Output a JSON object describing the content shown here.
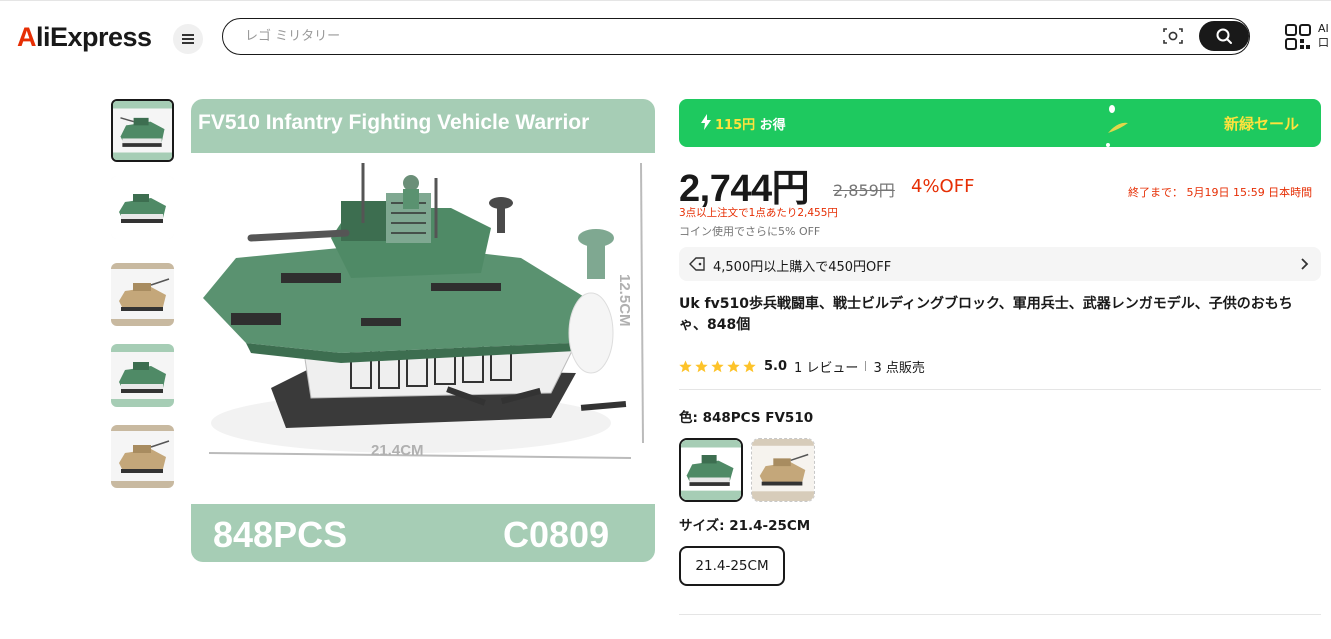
{
  "header": {
    "logo_text": "AliExpress",
    "logo_first": "A",
    "logo_rest": "liExpress",
    "search_placeholder": "レゴ ミリタリー",
    "qr_label": "AI 口",
    "icons": [
      "menu-icon",
      "camera-search-icon",
      "search-icon",
      "qr-code-icon"
    ]
  },
  "gallery": {
    "thumbnails": [
      {
        "theme": "green",
        "selected": true
      },
      {
        "theme": "white",
        "selected": false
      },
      {
        "theme": "tan",
        "selected": false
      },
      {
        "theme": "green",
        "selected": false
      },
      {
        "theme": "tan",
        "selected": false
      }
    ],
    "main_image": {
      "headline": "FV510 Infantry  Fighting Vehicle Warrior",
      "width_label": "21.4CM",
      "height_label": "12.5CM",
      "pcs_label": "848PCS",
      "code_label": "C0809"
    }
  },
  "product": {
    "sale_banner": {
      "savings_amount": "115円",
      "savings_suffix": " お得",
      "event_name": "新緑セール",
      "color": "#1ec95f"
    },
    "price": "2,744円",
    "original_price": "2,859円",
    "discount": "4%OFF",
    "sale_end": "終了まで： 5月19日 15:59 日本時間",
    "bulk_offer": "3点以上注文で1点あたり2,455円",
    "coin_offer": "コイン使用でさらに5% OFF",
    "coupon_text": "4,500円以上購入で450円OFF",
    "title": "Uk fv510歩兵戦闘車、戦士ビルディングブロック、軍用兵士、武器レンガモデル、子供のおもちゃ、848個",
    "rating": {
      "stars": 5,
      "score": "5.0",
      "reviews": "1 レビュー",
      "sold": "3 点販売"
    },
    "color_label": "色: 848PCS FV510",
    "color_options": [
      {
        "theme": "green",
        "selected": true
      },
      {
        "theme": "tan",
        "selected": false
      }
    ],
    "size_label": "サイズ: 21.4-25CM",
    "size_option": "21.4-25CM"
  },
  "colors": {
    "accent_red": "#e62e04",
    "sale_green": "#1ec95f",
    "sale_yellow": "#ffe23d",
    "star": "#fdc32a"
  }
}
